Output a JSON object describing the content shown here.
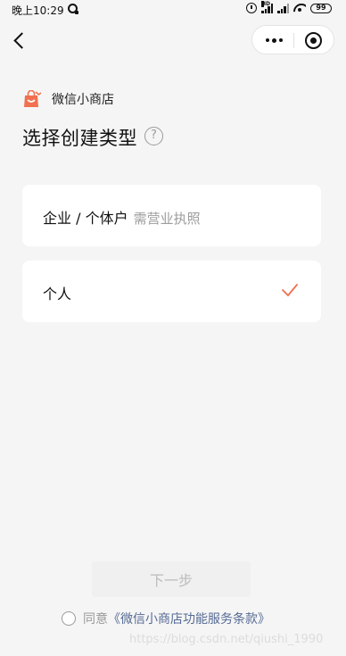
{
  "status_bar": {
    "time": "晚上10:29",
    "battery": "99",
    "signal_label": "HD"
  },
  "brand": {
    "name": "微信小商店",
    "logo_icon": "shop-bag-icon",
    "accent_color": "#f07050"
  },
  "page": {
    "title": "选择创建类型",
    "help_symbol": "?"
  },
  "options": [
    {
      "label": "企业 / 个体户",
      "hint": "需营业执照",
      "selected": false
    },
    {
      "label": "个人",
      "hint": "",
      "selected": true
    }
  ],
  "footer": {
    "next_label": "下一步",
    "agree_prefix": "同意",
    "terms_link": "《微信小商店功能服务条款》",
    "agreed": false
  },
  "watermark": "https://blog.csdn.net/qiushi_1990"
}
